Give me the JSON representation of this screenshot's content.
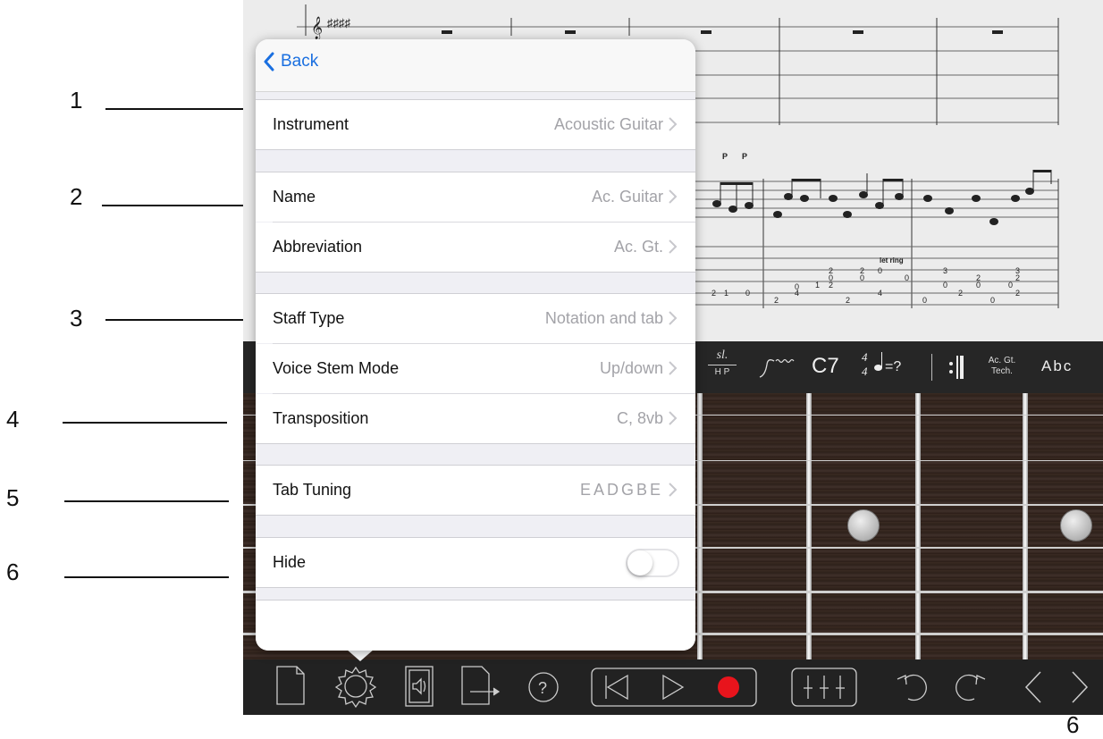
{
  "callouts": [
    "1",
    "2",
    "3",
    "4",
    "5",
    "6",
    "6"
  ],
  "popover": {
    "back_label": "Back",
    "rows": [
      {
        "label": "Instrument",
        "value": "Acoustic Guitar"
      },
      {
        "label": "Name",
        "value": "Ac. Guitar"
      },
      {
        "label": "Abbreviation",
        "value": "Ac. Gt."
      },
      {
        "label": "Staff Type",
        "value": "Notation and tab"
      },
      {
        "label": "Voice Stem Mode",
        "value": "Up/down"
      },
      {
        "label": "Transposition",
        "value": "C, 8vb"
      },
      {
        "label": "Tab Tuning",
        "value": "EADGBE"
      }
    ],
    "hide": {
      "label": "Hide",
      "on": false
    }
  },
  "score": {
    "hammer_label": "P",
    "let_ring": "let ring",
    "tab_numbers": [
      "2",
      "1",
      "0",
      "0",
      "4",
      "1",
      "2",
      "2",
      "0",
      "2",
      "0",
      "2",
      "4",
      "0",
      "0",
      "3",
      "0",
      "2",
      "0",
      "2",
      "0",
      "3",
      "2",
      "0",
      "2",
      "2",
      "0"
    ]
  },
  "palette": {
    "slide_label": "sl.",
    "hp_label": "H P",
    "chord": "C7",
    "time_sig_top": "4",
    "time_sig_bottom": "4",
    "tempo": "=?",
    "technique_line1": "Ac. Gt.",
    "technique_line2": "Tech.",
    "text_tool": "Abc"
  },
  "bottom_bar": {
    "icons": [
      "new-document",
      "settings",
      "mixer-speaker",
      "export",
      "help",
      "rewind",
      "play",
      "record",
      "mixer-faders",
      "undo",
      "redo",
      "previous",
      "next"
    ]
  },
  "colors": {
    "accent": "#1a6fe0",
    "record": "#e8141c"
  }
}
